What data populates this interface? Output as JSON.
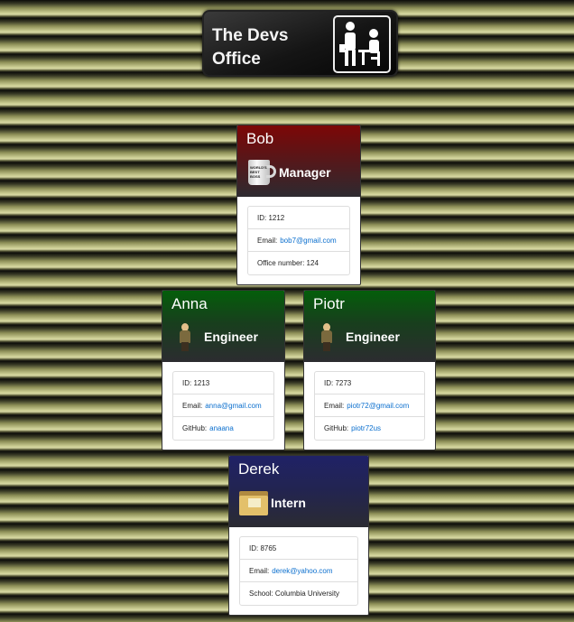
{
  "logo": {
    "line1": "The Devs",
    "line2": "Office"
  },
  "team": [
    {
      "name": "Bob",
      "role": "Manager",
      "icon": "coffee-mug-icon",
      "mug_text": "WORLD'S BEST BOSS",
      "id_label": "ID: 1212",
      "email_label": "Email:",
      "email": "bob7@gmail.com",
      "extra_label": "Office number: 124",
      "extra_link": ""
    },
    {
      "name": "Anna",
      "role": "Engineer",
      "icon": "dwight-figure-icon",
      "id_label": "ID: 1213",
      "email_label": "Email:",
      "email": "anna@gmail.com",
      "extra_label": "GitHub:",
      "extra_link": "anaana"
    },
    {
      "name": "Piotr",
      "role": "Engineer",
      "icon": "dwight-figure-icon",
      "id_label": "ID: 7273",
      "email_label": "Email:",
      "email": "piotr72@gmail.com",
      "extra_label": "GitHub:",
      "extra_link": "piotr72us"
    },
    {
      "name": "Derek",
      "role": "Intern",
      "icon": "folder-icon",
      "id_label": "ID: 8765",
      "email_label": "Email:",
      "email": "derek@yahoo.com",
      "extra_label": "School: Columbia University",
      "extra_link": ""
    }
  ],
  "colors": {
    "manager": "#7d0707",
    "engineer": "#045e0a",
    "intern": "#202266",
    "link": "#0b6fce"
  }
}
